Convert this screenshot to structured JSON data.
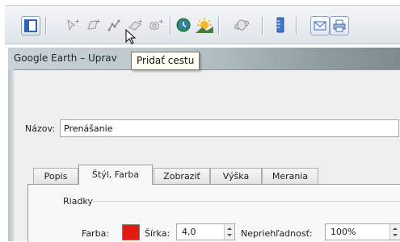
{
  "toolbar": {
    "buttons": [
      {
        "name": "sidebar-toggle-button",
        "icon": "sidebar-icon"
      },
      {
        "name": "add-placemark-button",
        "icon": "pushpin-icon"
      },
      {
        "name": "add-polygon-button",
        "icon": "polygon-icon"
      },
      {
        "name": "add-path-button",
        "icon": "path-icon"
      },
      {
        "name": "add-image-overlay-button",
        "icon": "image-overlay-icon"
      },
      {
        "name": "record-tour-button",
        "icon": "record-tour-icon"
      },
      {
        "name": "historical-imagery-button",
        "icon": "clock-icon"
      },
      {
        "name": "sunlight-button",
        "icon": "sun-icon"
      },
      {
        "name": "switch-to-sky-button",
        "icon": "planet-icon"
      },
      {
        "name": "ruler-button",
        "icon": "ruler-icon"
      },
      {
        "name": "email-button",
        "icon": "email-icon"
      },
      {
        "name": "print-button",
        "icon": "print-icon"
      }
    ]
  },
  "tooltip": {
    "text": "Pridať cestu"
  },
  "dialog": {
    "title": "Google Earth – Uprav",
    "name_label": "Názov:",
    "name_value": "Prenášanie",
    "tabs": [
      {
        "label": "Popis",
        "active": false
      },
      {
        "label": "Štýl, Farba",
        "active": true
      },
      {
        "label": "Zobraziť",
        "active": false
      },
      {
        "label": "Výška",
        "active": false
      },
      {
        "label": "Merania",
        "active": false
      }
    ],
    "lines": {
      "group_label": "Riadky",
      "color_label": "Farba:",
      "color": "#e31b12",
      "width_label": "Šírka:",
      "width_value": "4,0",
      "opacity_label": "Nepriehľadnosť:",
      "opacity_value": "100%"
    }
  }
}
